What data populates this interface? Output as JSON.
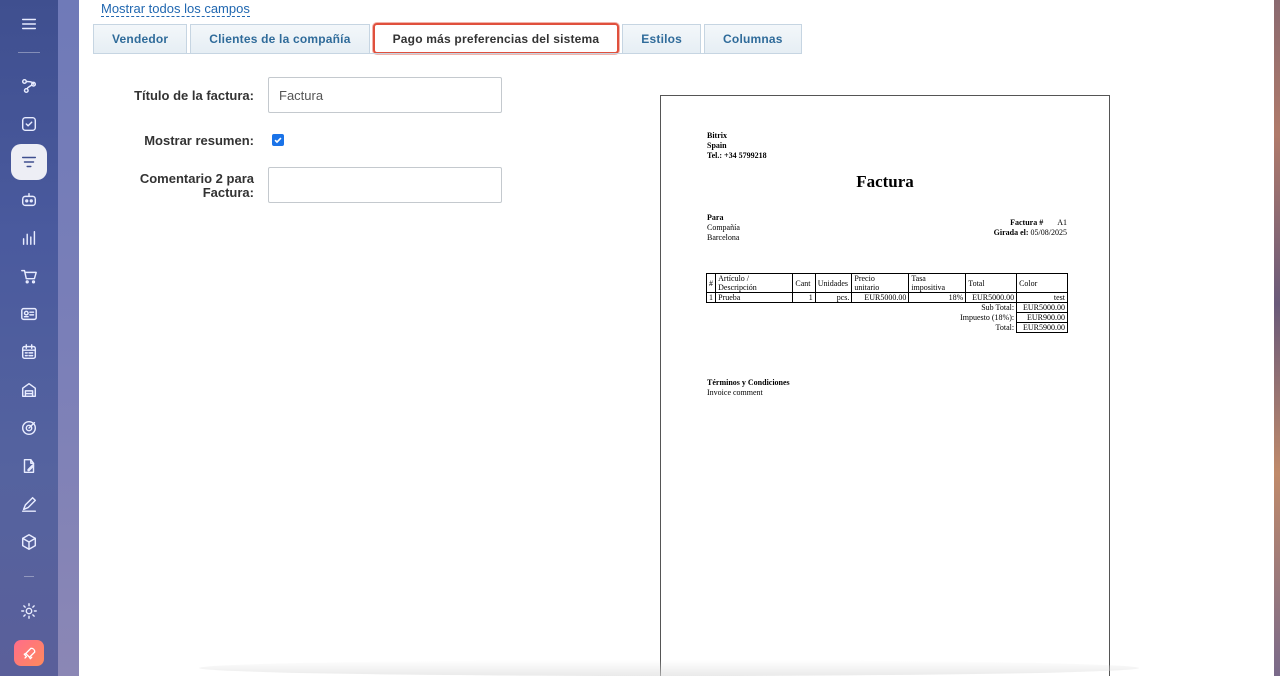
{
  "sidebar": {
    "items": [
      {
        "icon": "menu-icon"
      },
      {
        "icon": "flow-icon"
      },
      {
        "icon": "checkbox-icon"
      },
      {
        "icon": "filter-icon",
        "active": true
      },
      {
        "icon": "robot-icon"
      },
      {
        "icon": "chart-icon"
      },
      {
        "icon": "cart-icon"
      },
      {
        "icon": "contact-card-icon"
      },
      {
        "icon": "calendar-list-icon"
      },
      {
        "icon": "warehouse-icon"
      },
      {
        "icon": "target-icon"
      },
      {
        "icon": "document-edit-icon"
      },
      {
        "icon": "pen-icon"
      },
      {
        "icon": "box-icon"
      },
      {
        "icon": "gear-icon"
      },
      {
        "icon": "rocket-icon"
      }
    ]
  },
  "show_all_link": "Mostrar todos los campos",
  "tabs": [
    {
      "label": "Vendedor"
    },
    {
      "label": "Clientes de la compañía"
    },
    {
      "label": "Pago más preferencias del sistema",
      "active": true
    },
    {
      "label": "Estilos"
    },
    {
      "label": "Columnas"
    }
  ],
  "form": {
    "title_label": "Título de la factura:",
    "title_value": "Factura",
    "summary_label": "Mostrar resumen:",
    "summary_checked": true,
    "comment_label_line1": "Comentario 2 para",
    "comment_label_line2": "Factura:",
    "comment_value": ""
  },
  "invoice": {
    "company_name": "Bitrix",
    "company_country": "Spain",
    "company_phone": "Tel.: +34 5799218",
    "title": "Factura",
    "to_label": "Para",
    "to_company": "Compañía",
    "to_city": "Barcelona",
    "number_label": "Factura #",
    "number_value": "A1",
    "date_label": "Girada el:",
    "date_value": "05/08/2025",
    "columns": {
      "num": "#",
      "item_line1": "Artículo /",
      "item_line2": "Descripción",
      "qty": "Cant",
      "units": "Unidades",
      "price_line1": "Precio",
      "price_line2": "unitario",
      "tax_line1": "Tasa",
      "tax_line2": "impositiva",
      "total": "Total",
      "color": "Color"
    },
    "row": {
      "num": "1",
      "item": "Prueba",
      "qty": "1",
      "units": "pcs.",
      "price": "EUR5000.00",
      "tax": "18%",
      "total": "EUR5000.00",
      "color": "test"
    },
    "subtotal_label": "Sub Total:",
    "subtotal_value": "EUR5000.00",
    "tax_label": "Impuesto (18%):",
    "tax_value": "EUR900.00",
    "grand_label": "Total:",
    "grand_value": "EUR5900.00",
    "terms_title": "Términos y Condiciones",
    "terms_text": "Invoice comment"
  },
  "colors": {
    "accent_tab_border": "#e0503d",
    "link": "#2067b0",
    "tab_text": "#2f6b9a",
    "sidebar": "#3f4f8f",
    "checkbox": "#1a73e8"
  }
}
